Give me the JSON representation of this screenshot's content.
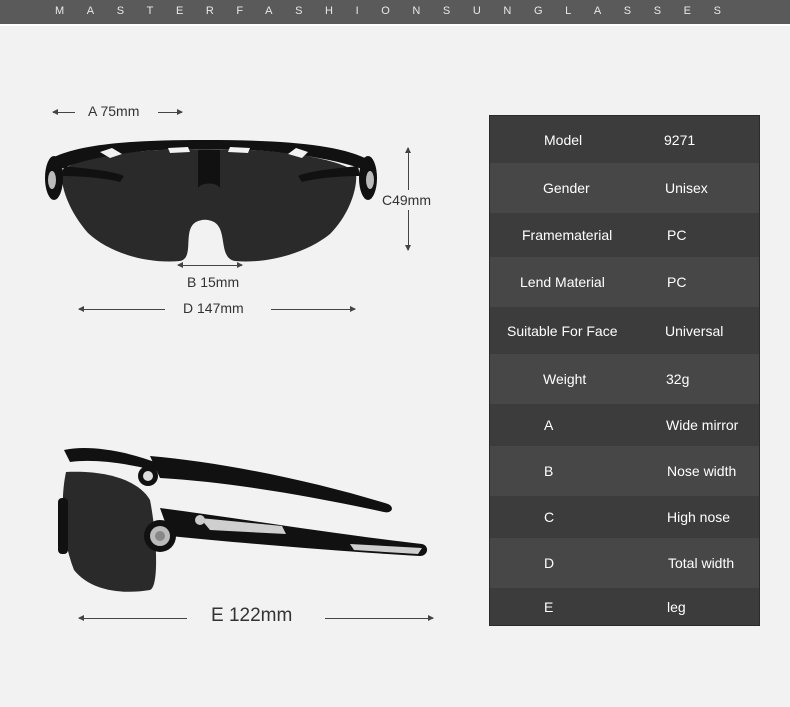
{
  "header": {
    "brand": "MASTERFASHIONSUNGLASSES"
  },
  "front_view": {
    "dim_a": "A 75mm",
    "dim_b": "B 15mm",
    "dim_c": "C49mm",
    "dim_d": "D 147mm"
  },
  "side_view": {
    "dim_e": "E 122mm"
  },
  "specs": [
    {
      "key": "Model",
      "value": "9271"
    },
    {
      "key": "Gender",
      "value": "Unisex"
    },
    {
      "key": "Framematerial",
      "value": "PC"
    },
    {
      "key": "Lend Material",
      "value": "PC"
    },
    {
      "key": "Suitable For Face",
      "value": "Universal"
    },
    {
      "key": "Weight",
      "value": "32g"
    },
    {
      "key": "A",
      "value": "Wide mirror"
    },
    {
      "key": "B",
      "value": "Nose width"
    },
    {
      "key": "C",
      "value": "High nose"
    },
    {
      "key": "D",
      "value": "Total width"
    },
    {
      "key": "E",
      "value": "leg"
    }
  ]
}
